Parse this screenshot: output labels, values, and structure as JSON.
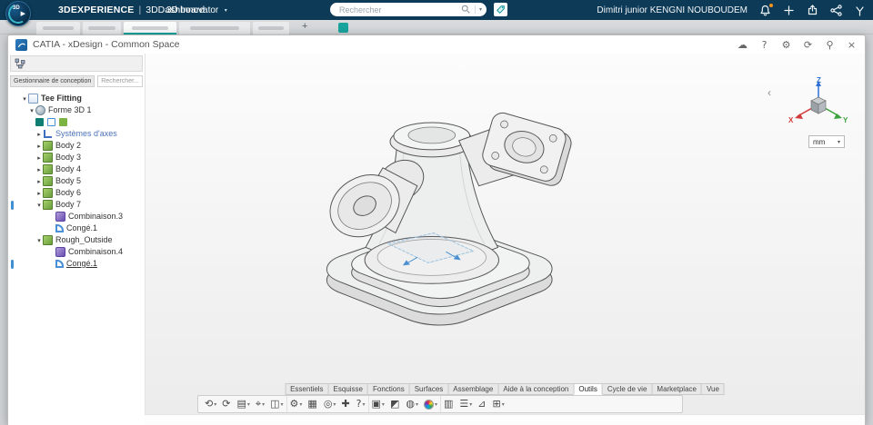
{
  "theme": {
    "topbar_bg": "#0d3a57",
    "accent_teal": "#18a39c",
    "badge_orange": "#f7941e",
    "selection_blue": "#3f8fd2",
    "axis_x_red": "#d23b3b",
    "axis_y_green": "#3ca23c",
    "axis_z_blue": "#2e6fd6"
  },
  "topbar": {
    "brand": "3DEXPERIENCE",
    "divider": "|",
    "platform": "3DDashboard",
    "context": "3D Innovator",
    "context_caret": "▾",
    "search_placeholder": "Rechercher",
    "user_name": "Dimitri junior KENGNI NOUBOUDEM"
  },
  "tabstrip": {
    "add_label": "+"
  },
  "window": {
    "title": "CATIA - xDesign - Common Space",
    "controls": [
      {
        "name": "cloud",
        "glyph": "☁"
      },
      {
        "name": "help",
        "glyph": "?"
      },
      {
        "name": "settings",
        "glyph": "⚙"
      },
      {
        "name": "refresh",
        "glyph": "⟳"
      },
      {
        "name": "pin",
        "glyph": "⚲"
      },
      {
        "name": "close",
        "glyph": "×"
      }
    ]
  },
  "left_panel": {
    "manager_label": "Gestionnaire de conception",
    "search_placeholder": "Rechercher...",
    "tree": [
      {
        "caret": "▾",
        "label": "Tee Fitting"
      },
      {
        "caret": "▾",
        "label": "Forme 3D 1"
      },
      {
        "caret": "",
        "label": ""
      },
      {
        "caret": "▸",
        "label": "Systèmes d'axes"
      },
      {
        "caret": "▸",
        "label": "Body 2"
      },
      {
        "caret": "▸",
        "label": "Body 3"
      },
      {
        "caret": "▸",
        "label": "Body 4"
      },
      {
        "caret": "▸",
        "label": "Body 5"
      },
      {
        "caret": "▸",
        "label": "Body 6"
      },
      {
        "caret": "▾",
        "label": "Body 7"
      },
      {
        "caret": "",
        "label": "Combinaison.3"
      },
      {
        "caret": "",
        "label": "Congé.1"
      },
      {
        "caret": "▾",
        "label": "Rough_Outside"
      },
      {
        "caret": "",
        "label": "Combinaison.4"
      },
      {
        "caret": "",
        "label": "Congé.1"
      }
    ]
  },
  "viewport": {
    "collapse_chevron": "‹",
    "units_value": "mm",
    "units_caret": "▾",
    "triad": {
      "x": "X",
      "y": "Y",
      "z": "Z"
    }
  },
  "action_bar": {
    "tabs": [
      "Essentiels",
      "Esquisse",
      "Fonctions",
      "Surfaces",
      "Assemblage",
      "Aide à la conception",
      "Outils",
      "Cycle de vie",
      "Marketplace",
      "Vue"
    ],
    "active_tab": "Outils",
    "tools": [
      {
        "name": "robot-manipulator-tool",
        "glyph": "⟲",
        "caret": "▾"
      },
      {
        "name": "update-tool",
        "glyph": "⟳",
        "caret": ""
      },
      {
        "name": "paste-special-tool",
        "glyph": "▤",
        "caret": "▾"
      },
      {
        "name": "measure-tool",
        "glyph": "⌖",
        "caret": "▾"
      },
      {
        "name": "section-view-tool",
        "glyph": "◫",
        "caret": "▾"
      },
      {
        "name": "mechanism-tool",
        "glyph": "⚙",
        "caret": "▾"
      },
      {
        "name": "pattern-grid-tool",
        "glyph": "▦",
        "caret": ""
      },
      {
        "name": "thread-tool",
        "glyph": "◎",
        "caret": "▾"
      },
      {
        "name": "move-tool",
        "glyph": "✚",
        "caret": ""
      },
      {
        "name": "help-assistant-tool",
        "glyph": "?",
        "caret": "▾"
      },
      {
        "name": "capture-image-tool",
        "glyph": "▣",
        "caret": "▾"
      },
      {
        "name": "render-style-tool",
        "glyph": "◩",
        "caret": ""
      },
      {
        "name": "globe-browser-tool",
        "glyph": "◍",
        "caret": "▾"
      },
      {
        "name": "color-material-tool",
        "glyph": "",
        "caret": "▾"
      },
      {
        "name": "chart-analysis-tool",
        "glyph": "▥",
        "caret": ""
      },
      {
        "name": "report-tool",
        "glyph": "☰",
        "caret": "▾"
      },
      {
        "name": "angle-measure-tool",
        "glyph": "⊿",
        "caret": ""
      },
      {
        "name": "data-table-tool",
        "glyph": "⊞",
        "caret": "▾"
      }
    ]
  }
}
